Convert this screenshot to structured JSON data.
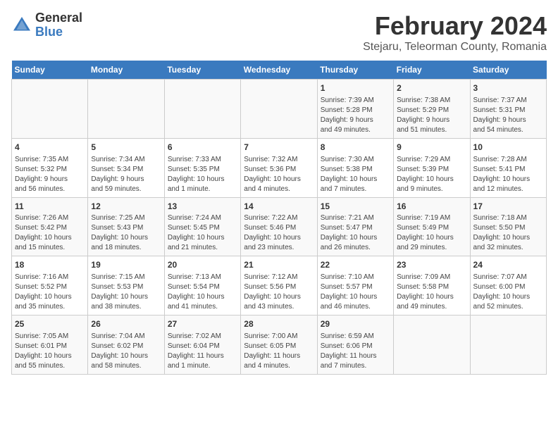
{
  "header": {
    "logo_general": "General",
    "logo_blue": "Blue",
    "main_title": "February 2024",
    "subtitle": "Stejaru, Teleorman County, Romania"
  },
  "weekdays": [
    "Sunday",
    "Monday",
    "Tuesday",
    "Wednesday",
    "Thursday",
    "Friday",
    "Saturday"
  ],
  "rows": [
    [
      {
        "day": "",
        "content": ""
      },
      {
        "day": "",
        "content": ""
      },
      {
        "day": "",
        "content": ""
      },
      {
        "day": "",
        "content": ""
      },
      {
        "day": "1",
        "content": "Sunrise: 7:39 AM\nSunset: 5:28 PM\nDaylight: 9 hours\nand 49 minutes."
      },
      {
        "day": "2",
        "content": "Sunrise: 7:38 AM\nSunset: 5:29 PM\nDaylight: 9 hours\nand 51 minutes."
      },
      {
        "day": "3",
        "content": "Sunrise: 7:37 AM\nSunset: 5:31 PM\nDaylight: 9 hours\nand 54 minutes."
      }
    ],
    [
      {
        "day": "4",
        "content": "Sunrise: 7:35 AM\nSunset: 5:32 PM\nDaylight: 9 hours\nand 56 minutes."
      },
      {
        "day": "5",
        "content": "Sunrise: 7:34 AM\nSunset: 5:34 PM\nDaylight: 9 hours\nand 59 minutes."
      },
      {
        "day": "6",
        "content": "Sunrise: 7:33 AM\nSunset: 5:35 PM\nDaylight: 10 hours\nand 1 minute."
      },
      {
        "day": "7",
        "content": "Sunrise: 7:32 AM\nSunset: 5:36 PM\nDaylight: 10 hours\nand 4 minutes."
      },
      {
        "day": "8",
        "content": "Sunrise: 7:30 AM\nSunset: 5:38 PM\nDaylight: 10 hours\nand 7 minutes."
      },
      {
        "day": "9",
        "content": "Sunrise: 7:29 AM\nSunset: 5:39 PM\nDaylight: 10 hours\nand 9 minutes."
      },
      {
        "day": "10",
        "content": "Sunrise: 7:28 AM\nSunset: 5:41 PM\nDaylight: 10 hours\nand 12 minutes."
      }
    ],
    [
      {
        "day": "11",
        "content": "Sunrise: 7:26 AM\nSunset: 5:42 PM\nDaylight: 10 hours\nand 15 minutes."
      },
      {
        "day": "12",
        "content": "Sunrise: 7:25 AM\nSunset: 5:43 PM\nDaylight: 10 hours\nand 18 minutes."
      },
      {
        "day": "13",
        "content": "Sunrise: 7:24 AM\nSunset: 5:45 PM\nDaylight: 10 hours\nand 21 minutes."
      },
      {
        "day": "14",
        "content": "Sunrise: 7:22 AM\nSunset: 5:46 PM\nDaylight: 10 hours\nand 23 minutes."
      },
      {
        "day": "15",
        "content": "Sunrise: 7:21 AM\nSunset: 5:47 PM\nDaylight: 10 hours\nand 26 minutes."
      },
      {
        "day": "16",
        "content": "Sunrise: 7:19 AM\nSunset: 5:49 PM\nDaylight: 10 hours\nand 29 minutes."
      },
      {
        "day": "17",
        "content": "Sunrise: 7:18 AM\nSunset: 5:50 PM\nDaylight: 10 hours\nand 32 minutes."
      }
    ],
    [
      {
        "day": "18",
        "content": "Sunrise: 7:16 AM\nSunset: 5:52 PM\nDaylight: 10 hours\nand 35 minutes."
      },
      {
        "day": "19",
        "content": "Sunrise: 7:15 AM\nSunset: 5:53 PM\nDaylight: 10 hours\nand 38 minutes."
      },
      {
        "day": "20",
        "content": "Sunrise: 7:13 AM\nSunset: 5:54 PM\nDaylight: 10 hours\nand 41 minutes."
      },
      {
        "day": "21",
        "content": "Sunrise: 7:12 AM\nSunset: 5:56 PM\nDaylight: 10 hours\nand 43 minutes."
      },
      {
        "day": "22",
        "content": "Sunrise: 7:10 AM\nSunset: 5:57 PM\nDaylight: 10 hours\nand 46 minutes."
      },
      {
        "day": "23",
        "content": "Sunrise: 7:09 AM\nSunset: 5:58 PM\nDaylight: 10 hours\nand 49 minutes."
      },
      {
        "day": "24",
        "content": "Sunrise: 7:07 AM\nSunset: 6:00 PM\nDaylight: 10 hours\nand 52 minutes."
      }
    ],
    [
      {
        "day": "25",
        "content": "Sunrise: 7:05 AM\nSunset: 6:01 PM\nDaylight: 10 hours\nand 55 minutes."
      },
      {
        "day": "26",
        "content": "Sunrise: 7:04 AM\nSunset: 6:02 PM\nDaylight: 10 hours\nand 58 minutes."
      },
      {
        "day": "27",
        "content": "Sunrise: 7:02 AM\nSunset: 6:04 PM\nDaylight: 11 hours\nand 1 minute."
      },
      {
        "day": "28",
        "content": "Sunrise: 7:00 AM\nSunset: 6:05 PM\nDaylight: 11 hours\nand 4 minutes."
      },
      {
        "day": "29",
        "content": "Sunrise: 6:59 AM\nSunset: 6:06 PM\nDaylight: 11 hours\nand 7 minutes."
      },
      {
        "day": "",
        "content": ""
      },
      {
        "day": "",
        "content": ""
      }
    ]
  ]
}
